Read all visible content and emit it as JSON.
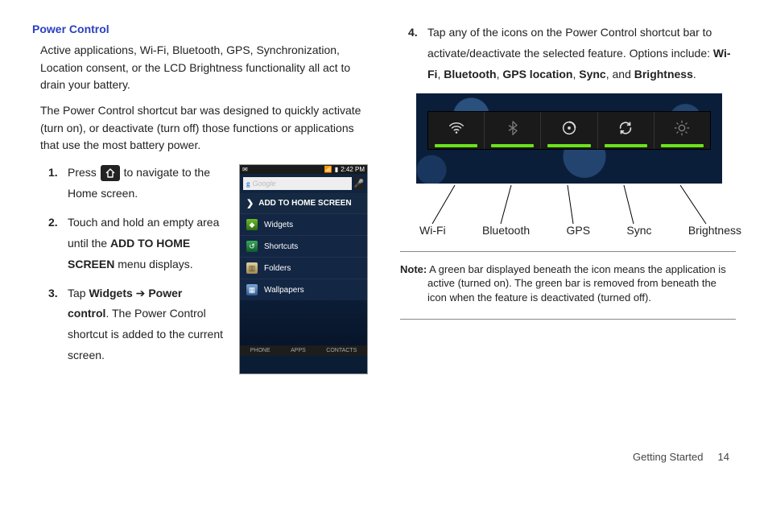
{
  "heading": "Power Control",
  "para1": "Active applications, Wi-Fi, Bluetooth, GPS, Synchronization, Location consent, or the LCD Brightness functionality all act to drain your battery.",
  "para2": "The Power Control shortcut bar was designed to quickly activate (turn on), or deactivate (turn off) those functions or applications that use the most battery power.",
  "step1_a": "Press ",
  "step1_b": " to navigate to the Home screen.",
  "step2_a": "Touch and hold an empty area until the ",
  "step2_bold": "ADD TO HOME SCREEN",
  "step2_b": " menu displays.",
  "step3_a": "Tap ",
  "step3_b1": "Widgets",
  "step3_arrow": " ➔ ",
  "step3_b2": "Power control",
  "step3_c": ". The Power Control shortcut is added to the current screen.",
  "step4_a": "Tap any of the icons on the Power Control shortcut bar to activate/deactivate the selected feature. Options include: ",
  "step4_o1": "Wi-Fi",
  "step4_o2": "Bluetooth",
  "step4_o3": "GPS location",
  "step4_o4": "Sync",
  "step4_o5": "Brightness",
  "phone": {
    "clock": "2:42 PM",
    "search_placeholder": "Google",
    "menu_head": "ADD TO HOME SCREEN",
    "items": [
      "Widgets",
      "Shortcuts",
      "Folders",
      "Wallpapers"
    ],
    "bottom": [
      "PHONE",
      "APPS",
      "CONTACTS"
    ]
  },
  "labels": {
    "wifi": "Wi-Fi",
    "bt": "Bluetooth",
    "gps": "GPS",
    "sync": "Sync",
    "bright": "Brightness"
  },
  "note_label": "Note:",
  "note_text": " A green bar displayed beneath the icon means the application is active (turned on). The green bar is removed from beneath the icon when the feature is deactivated (turned off).",
  "footer_section": "Getting Started",
  "footer_page": "14"
}
